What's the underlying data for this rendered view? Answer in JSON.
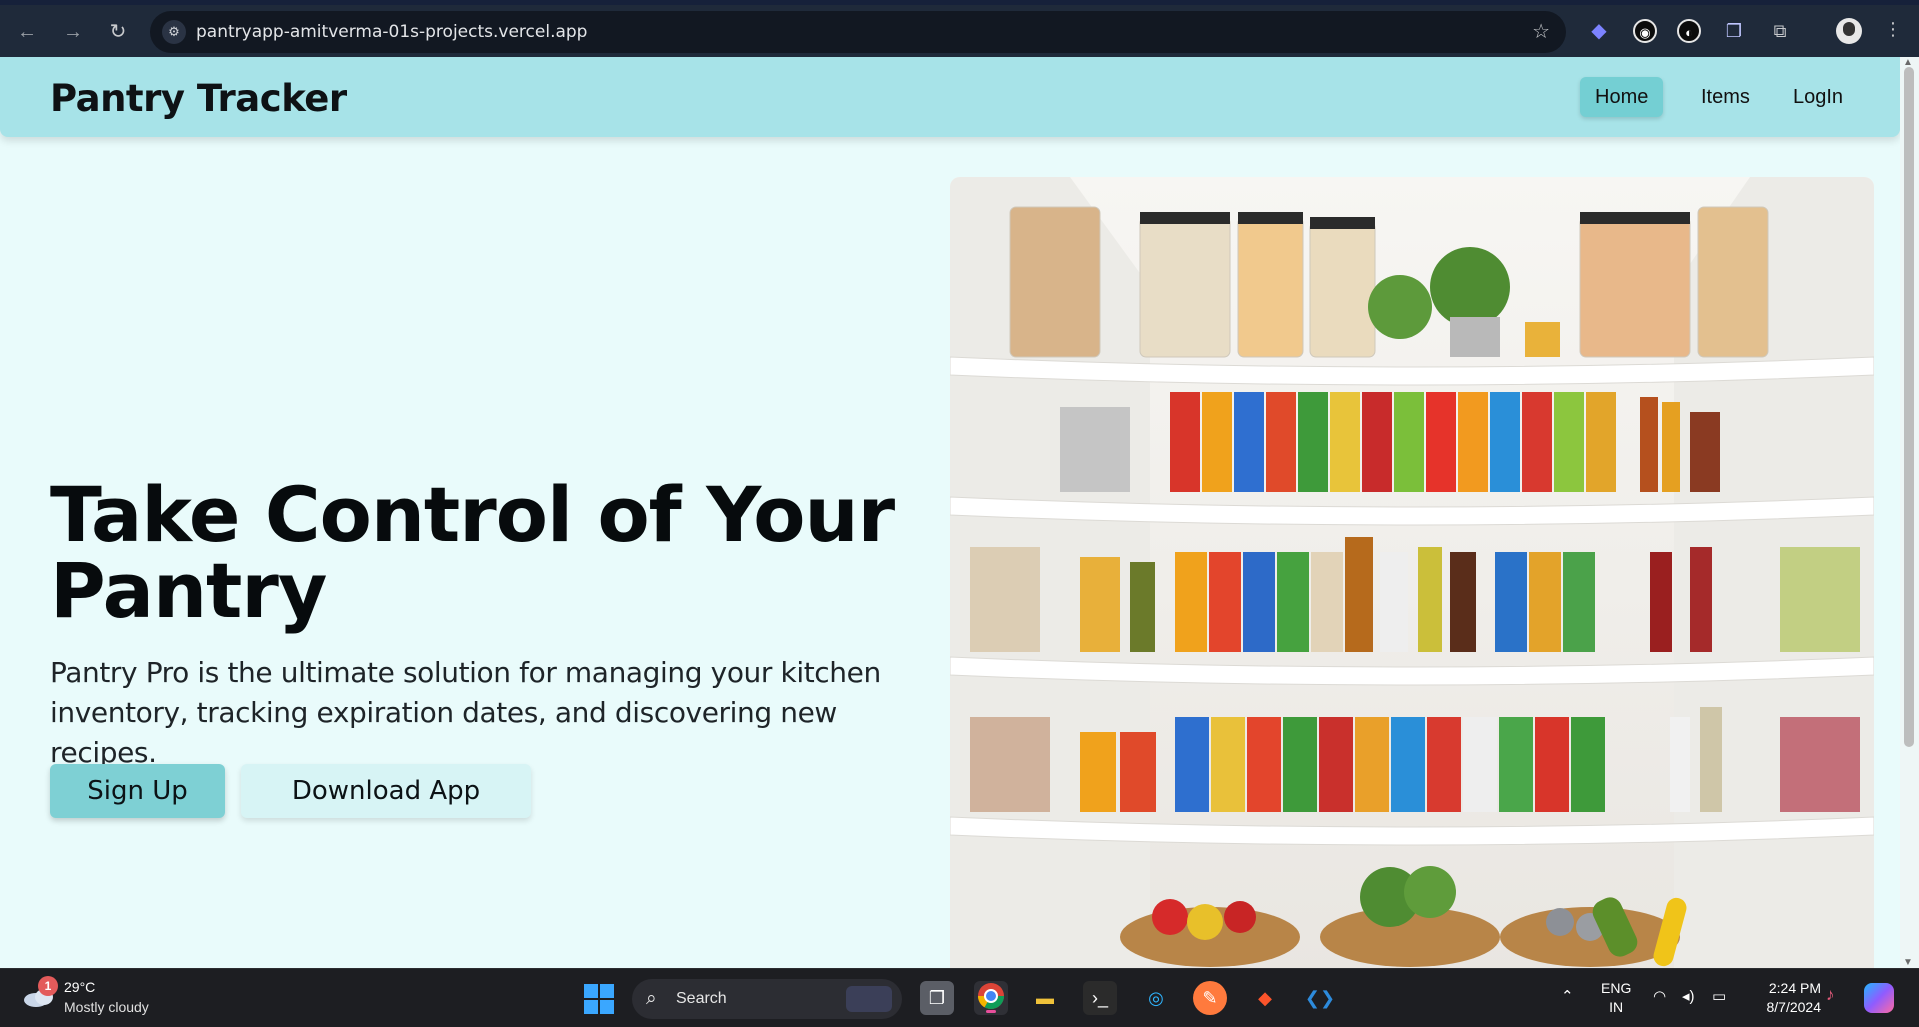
{
  "browser": {
    "url": "pantryapp-amitverma-01s-projects.vercel.app"
  },
  "app": {
    "brand": "Pantry Tracker",
    "nav": {
      "home": "Home",
      "items": "Items",
      "login": "LogIn"
    },
    "hero": {
      "title": "Take Control of Your Pantry",
      "description": "Pantry Pro is the ultimate solution for managing your kitchen inventory, tracking expiration dates, and discovering new recipes.",
      "signup_label": "Sign Up",
      "download_label": "Download App"
    }
  },
  "taskbar": {
    "weather": {
      "badge": "1",
      "temperature": "29°C",
      "condition": "Mostly cloudy"
    },
    "search_label": "Search",
    "language": {
      "line1": "ENG",
      "line2": "IN"
    },
    "clock": {
      "time": "2:24 PM",
      "date": "8/7/2024"
    }
  },
  "colors": {
    "header_bg": "#a7e3e8",
    "page_bg": "#e9fbfb",
    "accent": "#74cfd3",
    "secondary_button": "#d7f4f5"
  },
  "icons": [
    "back-arrow-icon",
    "forward-arrow-icon",
    "reload-icon",
    "site-info-icon",
    "bookmark-star-icon",
    "extensions-icon",
    "windows-start-icon",
    "search-icon"
  ]
}
